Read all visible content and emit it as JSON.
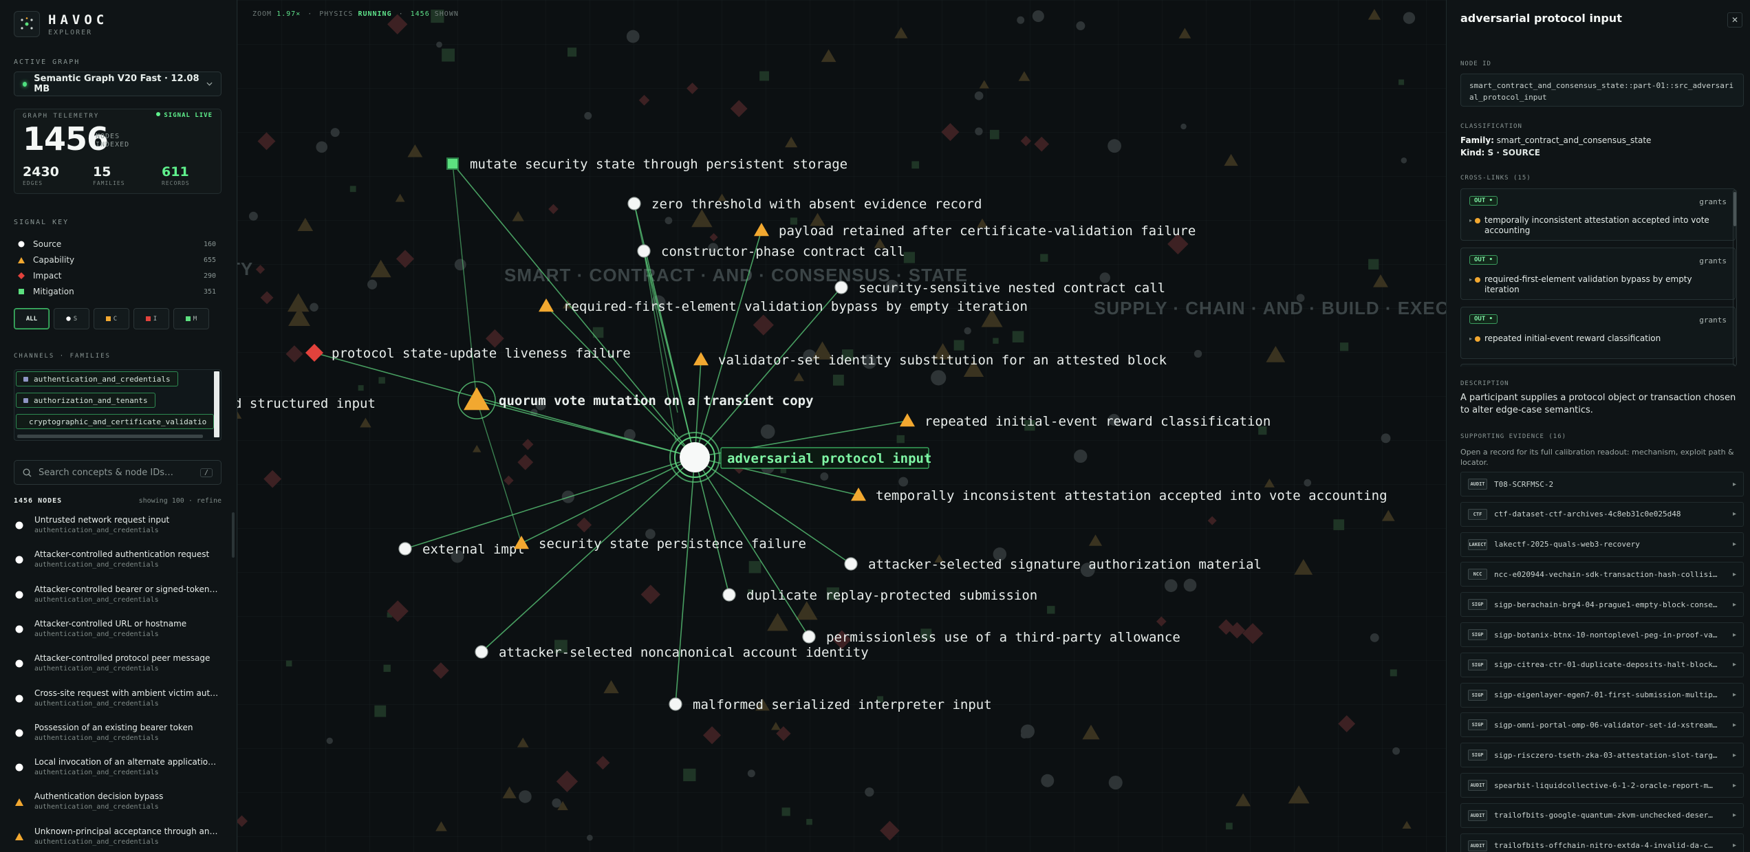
{
  "brand": {
    "name": "HAVOC",
    "sub": "EXPLORER"
  },
  "active_graph": {
    "label": "ACTIVE GRAPH",
    "selected": "Semantic Graph V20 Fast · 12.08 MB"
  },
  "telemetry": {
    "label": "GRAPH TELEMETRY",
    "live": "SIGNAL LIVE",
    "nodes": "1456",
    "nodes_label_1": "NODES",
    "nodes_label_2": "INDEXED",
    "edges": "2430",
    "edges_label": "EDGES",
    "families": "15",
    "families_label": "FAMILIES",
    "records": "611",
    "records_label": "RECORDS"
  },
  "signal_key": {
    "label": "SIGNAL KEY",
    "items": [
      {
        "name": "Source",
        "count": "160",
        "shape": "circle",
        "color": "#ffffff"
      },
      {
        "name": "Capability",
        "count": "655",
        "shape": "triangle",
        "color": "#f2a830"
      },
      {
        "name": "Impact",
        "count": "290",
        "shape": "diamond",
        "color": "#e2423c"
      },
      {
        "name": "Mitigation",
        "count": "351",
        "shape": "square",
        "color": "#5ce07f"
      }
    ]
  },
  "filters": [
    {
      "label": "ALL",
      "active": true
    },
    {
      "label": "S",
      "color": "#ffffff"
    },
    {
      "label": "C",
      "color": "#f2a830"
    },
    {
      "label": "I",
      "color": "#e2423c"
    },
    {
      "label": "M",
      "color": "#5ce07f"
    }
  ],
  "channels": {
    "label": "CHANNELS · FAMILIES",
    "items": [
      "authentication_and_credentials",
      "authorization_and_tenants",
      "cryptographic_and_certificate_validatio"
    ]
  },
  "search": {
    "placeholder": "Search concepts & node IDs…",
    "shortcut": "/"
  },
  "node_list": {
    "count_label": "1456 NODES",
    "showing": "showing 100 · refine",
    "items": [
      {
        "title": "Untrusted network request input",
        "family": "authentication_and_credentials",
        "kind": "source"
      },
      {
        "title": "Attacker-controlled authentication request",
        "family": "authentication_and_credentials",
        "kind": "source"
      },
      {
        "title": "Attacker-controlled bearer or signed-token in…",
        "family": "authentication_and_credentials",
        "kind": "source"
      },
      {
        "title": "Attacker-controlled URL or hostname",
        "family": "authentication_and_credentials",
        "kind": "source"
      },
      {
        "title": "Attacker-controlled protocol peer message",
        "family": "authentication_and_credentials",
        "kind": "source"
      },
      {
        "title": "Cross-site request with ambient victim authe…",
        "family": "authentication_and_credentials",
        "kind": "source"
      },
      {
        "title": "Possession of an existing bearer token",
        "family": "authentication_and_credentials",
        "kind": "source"
      },
      {
        "title": "Local invocation of an alternate application e…",
        "family": "authentication_and_credentials",
        "kind": "source"
      },
      {
        "title": "Authentication decision bypass",
        "family": "authentication_and_credentials",
        "kind": "capability"
      },
      {
        "title": "Unknown-principal acceptance through an e…",
        "family": "authentication_and_credentials",
        "kind": "capability"
      }
    ]
  },
  "canvas": {
    "zoom_label": "ZOOM",
    "zoom": "1.97×",
    "physics_label": "PHYSICS",
    "physics": "RUNNING",
    "shown": "1456",
    "shown_label": "SHOWN",
    "family_watermarks": [
      "SMART · CONTRACT · AND · CONSENSUS · STATE",
      "SUPPLY · CHAIN · AND · BUILD · EXECUTION",
      "TY"
    ],
    "center": {
      "label": "adversarial protocol input",
      "kind": "source"
    },
    "nodes": [
      {
        "label": "mutate security state through persistent storage",
        "kind": "mitigation"
      },
      {
        "label": "zero threshold with absent evidence record",
        "kind": "source"
      },
      {
        "label": "payload retained after certificate-validation failure",
        "kind": "capability"
      },
      {
        "label": "constructor-phase contract call",
        "kind": "source"
      },
      {
        "label": "security-sensitive nested contract call",
        "kind": "source"
      },
      {
        "label": "required-first-element validation bypass by empty iteration",
        "kind": "capability"
      },
      {
        "label": "protocol state-update liveness failure",
        "kind": "impact"
      },
      {
        "label": "validator-set identity substitution for an attested block",
        "kind": "capability"
      },
      {
        "label": "quorum vote mutation on a transient copy",
        "kind": "capability"
      },
      {
        "label": "repeated initial-event reward classification",
        "kind": "capability"
      },
      {
        "label": "temporally inconsistent attestation accepted into vote accounting",
        "kind": "capability"
      },
      {
        "label": "external impl",
        "kind": "source"
      },
      {
        "label": "security state persistence failure",
        "kind": "capability"
      },
      {
        "label": "attacker-selected signature authorization material",
        "kind": "source"
      },
      {
        "label": "duplicate replay-protected submission",
        "kind": "source"
      },
      {
        "label": "permissionless use of a third-party allowance",
        "kind": "source"
      },
      {
        "label": "attacker-selected noncanonical account identity",
        "kind": "source"
      },
      {
        "label": "malformed serialized interpreter input",
        "kind": "source"
      },
      {
        "label": "d structured input",
        "kind": "source"
      }
    ]
  },
  "detail": {
    "title": "adversarial protocol input",
    "close": "✕",
    "node_id_label": "NODE ID",
    "node_id": "smart_contract_and_consensus_state::part-01::src_adversarial_protocol_input",
    "classification_label": "CLASSIFICATION",
    "family_key": "Family:",
    "family": "smart_contract_and_consensus_state",
    "kind_key": "Kind:",
    "kind": "S · SOURCE",
    "crosslinks_label": "CROSS-LINKS (15)",
    "crosslinks": [
      {
        "dir": "OUT •",
        "rel": "grants",
        "target": "temporally inconsistent attestation accepted into vote accounting"
      },
      {
        "dir": "OUT •",
        "rel": "grants",
        "target": "required-first-element validation bypass by empty iteration"
      },
      {
        "dir": "OUT •",
        "rel": "grants",
        "target": "repeated initial-event reward classification"
      }
    ],
    "description_label": "DESCRIPTION",
    "description": "A participant supplies a protocol object or transaction chosen to alter edge-case semantics.",
    "evidence_label": "SUPPORTING EVIDENCE (16)",
    "evidence_sub": "Open a record for its full calibration readout: mechanism, exploit path & locator.",
    "evidence": [
      {
        "tag": "AUDIT",
        "name": "T08-SCRFMSC-2"
      },
      {
        "tag": "CTF",
        "name": "ctf-dataset-ctf-archives-4c8eb31c0e025d48"
      },
      {
        "tag": "LAKECT",
        "name": "lakectf-2025-quals-web3-recovery"
      },
      {
        "tag": "NCC",
        "name": "ncc-e020944-vechain-sdk-transaction-hash-collisio…"
      },
      {
        "tag": "SIGP",
        "name": "sigp-berachain-brg4-04-prague1-empty-block-conse…"
      },
      {
        "tag": "SIGP",
        "name": "sigp-botanix-btnx-10-nontoplevel-peg-in-proof-va…"
      },
      {
        "tag": "SIGP",
        "name": "sigp-citrea-ctr-01-duplicate-deposits-halt-block…"
      },
      {
        "tag": "SIGP",
        "name": "sigp-eigenlayer-egen7-01-first-submission-multip…"
      },
      {
        "tag": "SIGP",
        "name": "sigp-omni-portal-omp-06-validator-set-id-xstream…"
      },
      {
        "tag": "SIGP",
        "name": "sigp-risczero-tseth-zka-03-attestation-slot-targ…"
      },
      {
        "tag": "AUDIT",
        "name": "spearbit-liquidcollective-6-1-2-oracle-report-m…"
      },
      {
        "tag": "AUDIT",
        "name": "trailofbits-google-quantum-zkvm-unchecked-deser…"
      },
      {
        "tag": "AUDIT",
        "name": "trailofbits-offchain-nitro-extda-4-invalid-da-c…"
      }
    ]
  }
}
